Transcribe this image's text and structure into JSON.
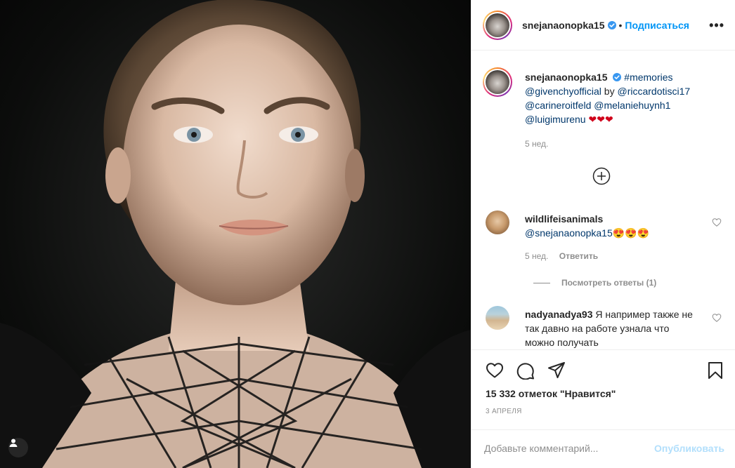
{
  "post": {
    "username": "snejanaonopka15",
    "follow_label": "Подписаться",
    "dot": "•",
    "more_label": "•••"
  },
  "caption": {
    "username": "snejanaonopka15",
    "hashtag": "#memories",
    "mention1": "@givenchyofficial",
    "by": "by",
    "mention2": "@riccardotisci17",
    "mention3": "@carineroitfeld",
    "mention4": "@melaniehuynh1",
    "mention5": "@luigimurenu",
    "hearts": "❤❤❤",
    "time": "5 нед."
  },
  "comments": [
    {
      "username": "wildlifeisanimals",
      "text": "@snejanaonopka15",
      "emoji": "😍😍😍",
      "time": "5 нед.",
      "reply_label": "Ответить",
      "view_replies": "Посмотреть ответы (1)"
    },
    {
      "username": "nadyanadya93",
      "text": "Я например также не так давно на работе узнала что можно получать"
    }
  ],
  "actions": {
    "likes": "15 332 отметок \"Нравится\"",
    "date": "3 апреля"
  },
  "add_comment": {
    "placeholder": "Добавьте комментарий...",
    "publish_label": "Опубликовать"
  },
  "colors": {
    "accent": "#0095f6",
    "link": "#00376b",
    "muted": "#8e8e8e",
    "publish_disabled": "#b2dffc"
  }
}
